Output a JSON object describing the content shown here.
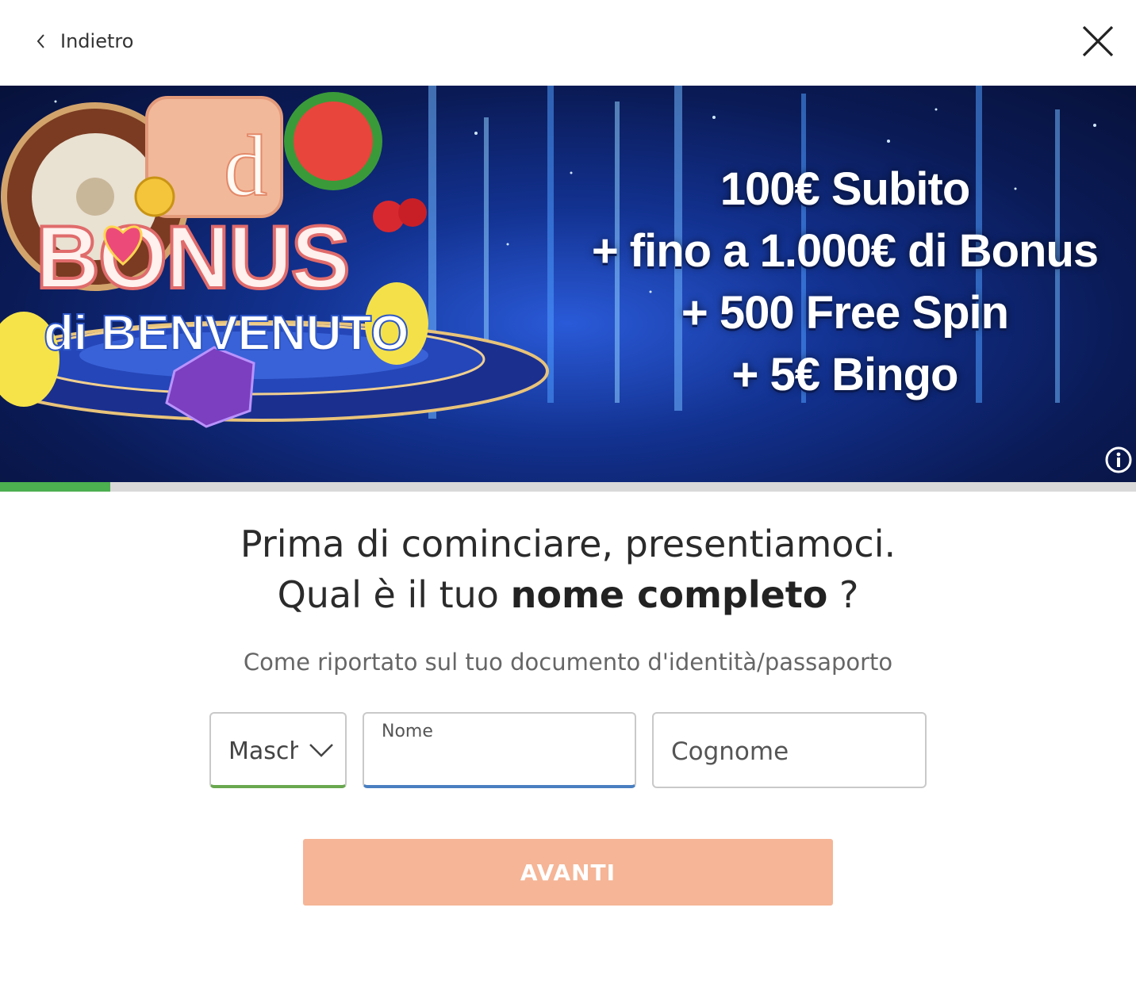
{
  "topbar": {
    "back_label": "Indietro",
    "back_icon": "chevron-left-icon",
    "close_icon": "close-icon"
  },
  "banner": {
    "logo_word": "BONUS",
    "logo_sub": "di BENVENUTO",
    "logo_letter": "d",
    "promo_lines": [
      "100€ Subito",
      "+ fino a 1.000€ di Bonus",
      "+ 500 Free Spin",
      "+ 5€ Bingo"
    ],
    "info_icon": "info-icon"
  },
  "progress": {
    "fraction": 0.097,
    "color": "#4caf50"
  },
  "heading": {
    "line1": "Prima di cominciare, presentiamoci.",
    "line2_prefix": "Qual è il tuo",
    "line2_bold": "nome completo",
    "line2_suffix": "?"
  },
  "subheading": "Come riportato sul tuo documento d'identità/passaporto",
  "form": {
    "gender_value": "Maschio",
    "first_name_label": "Nome",
    "first_name_value": "",
    "last_name_placeholder": "Cognome"
  },
  "submit_label": "AVANTI",
  "colors": {
    "accent_green": "#6aa84f",
    "focus_blue": "#4a7fc1",
    "button": "#f5b596"
  }
}
